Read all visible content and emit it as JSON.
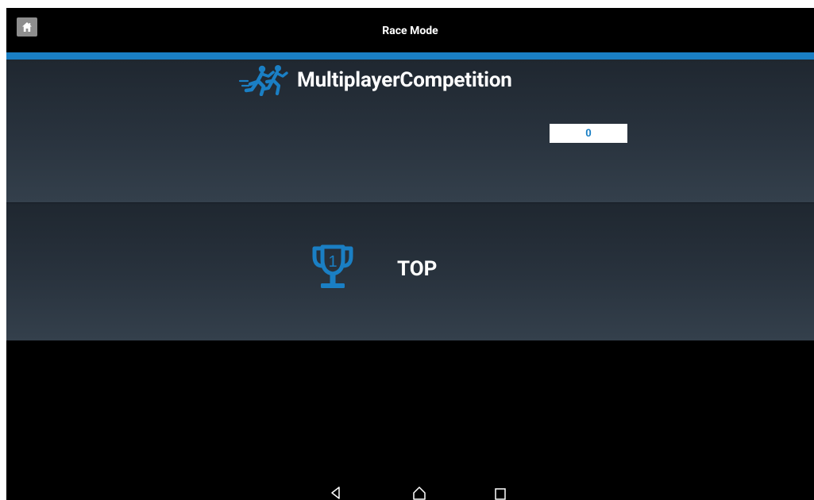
{
  "app": {
    "title": "Race Mode"
  },
  "topbar": {
    "home_icon": "home-icon"
  },
  "menu": {
    "competition": {
      "label": "MultiplayerCompetition",
      "count": "0",
      "icon": "runners-icon"
    },
    "top": {
      "label": "TOP",
      "icon": "trophy-icon",
      "rank_glyph": "1"
    }
  },
  "navbar": {
    "back_icon": "back-triangle-icon",
    "home_icon": "home-circle-icon",
    "recents_icon": "recents-square-icon"
  },
  "colors": {
    "accent": "#1a7fc4",
    "background": "#000000",
    "panel": "#29333e",
    "text": "#ffffff"
  }
}
